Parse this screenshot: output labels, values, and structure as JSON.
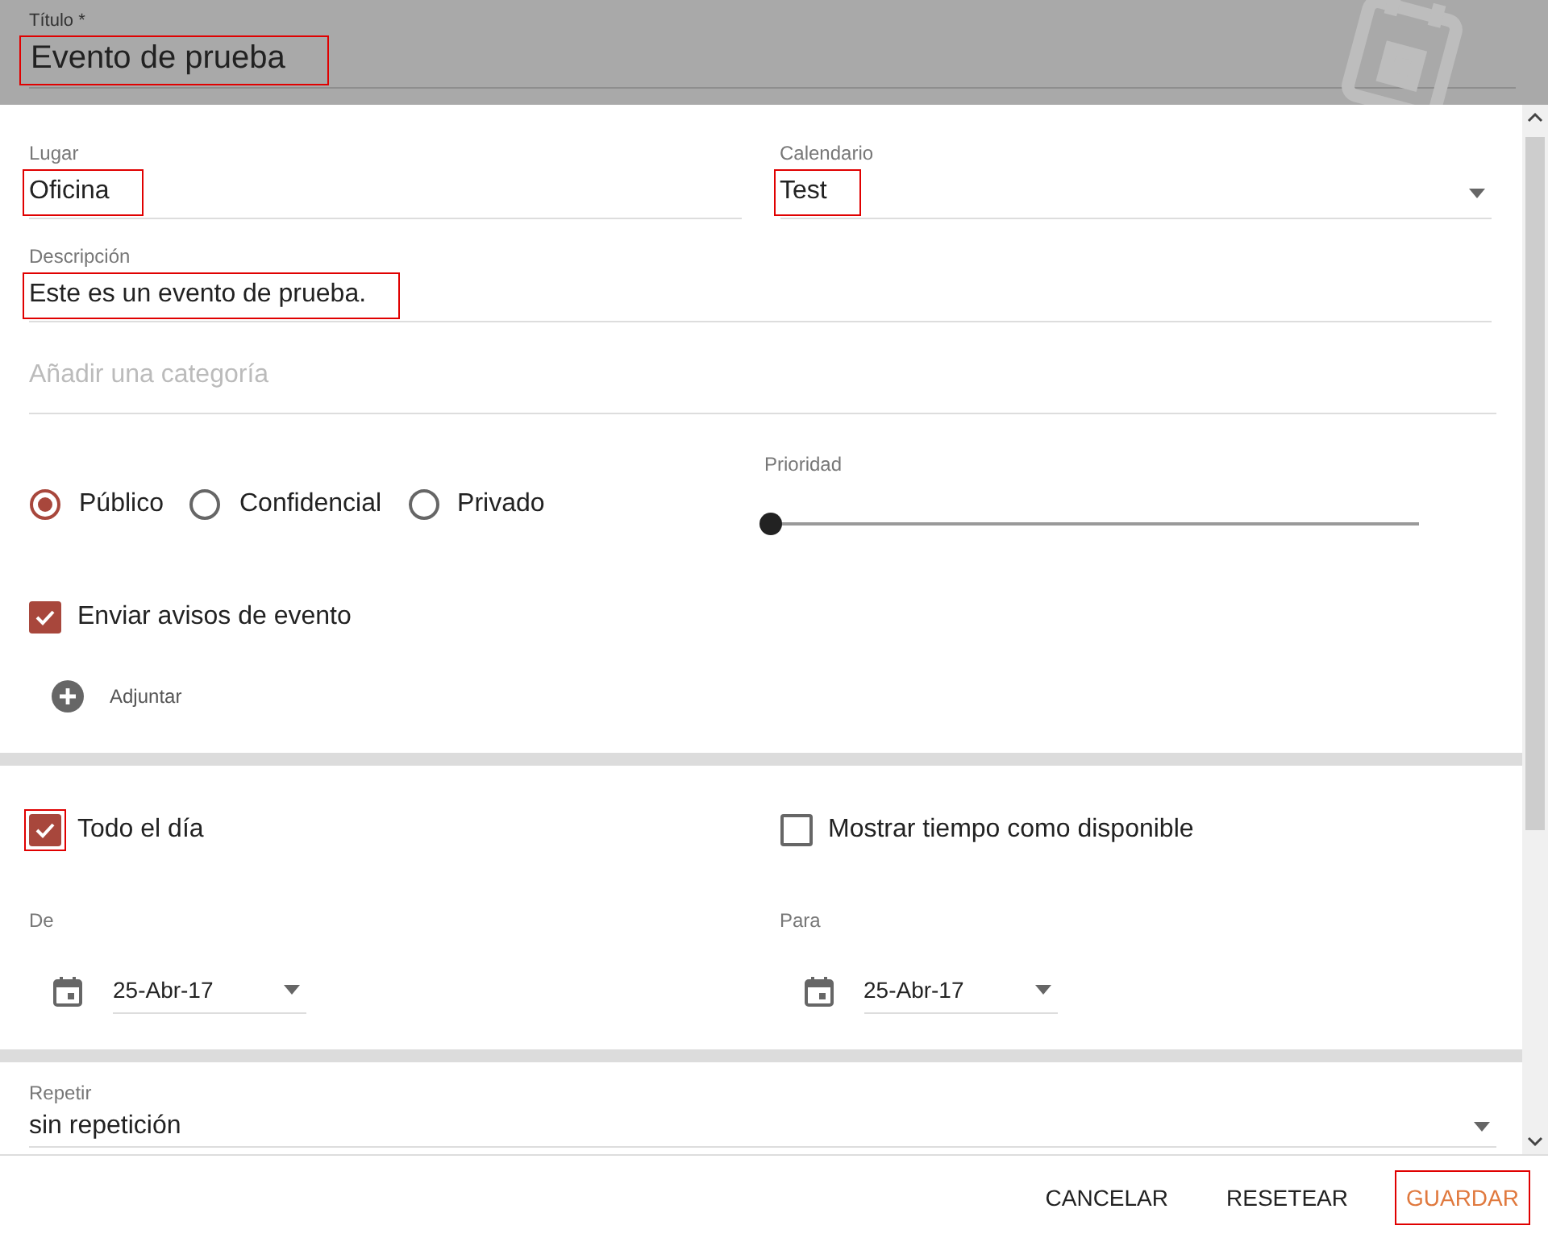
{
  "header": {
    "label": "Título *",
    "value": "Evento de prueba",
    "highlighted": true
  },
  "fields_row": [
    {
      "kind": "text",
      "label": "Lugar",
      "value": "Oficina",
      "highlighted": true
    },
    {
      "kind": "select",
      "label": "Calendario",
      "value": "Test",
      "highlighted": true
    }
  ],
  "description": {
    "label": "Descripción",
    "value": "Este es un evento de prueba.",
    "highlighted": true
  },
  "category": {
    "placeholder": "Añadir una categoría"
  },
  "visibility": [
    {
      "label": "Público",
      "selected": true
    },
    {
      "label": "Confidencial",
      "selected": false
    },
    {
      "label": "Privado",
      "selected": false
    }
  ],
  "priority": {
    "label": "Prioridad",
    "level": 0
  },
  "send_notifications": {
    "label": "Enviar avisos de evento",
    "checked": true,
    "highlighted": false
  },
  "attach": {
    "label": "Adjuntar"
  },
  "all_day": {
    "label": "Todo el día",
    "checked": true,
    "highlighted": true
  },
  "show_available": {
    "label": "Mostrar tiempo como disponible",
    "checked": false,
    "highlighted": false
  },
  "dates": [
    {
      "label": "De",
      "value": "25-Abr-17"
    },
    {
      "label": "Para",
      "value": "25-Abr-17"
    }
  ],
  "repeat": {
    "label": "Repetir",
    "value": "sin repetición"
  },
  "buttons": [
    {
      "label": "CANCELAR",
      "kind": "plain",
      "highlighted": false
    },
    {
      "label": "RESETEAR",
      "kind": "plain",
      "highlighted": false
    },
    {
      "label": "GUARDAR",
      "kind": "primary",
      "highlighted": true
    }
  ]
}
